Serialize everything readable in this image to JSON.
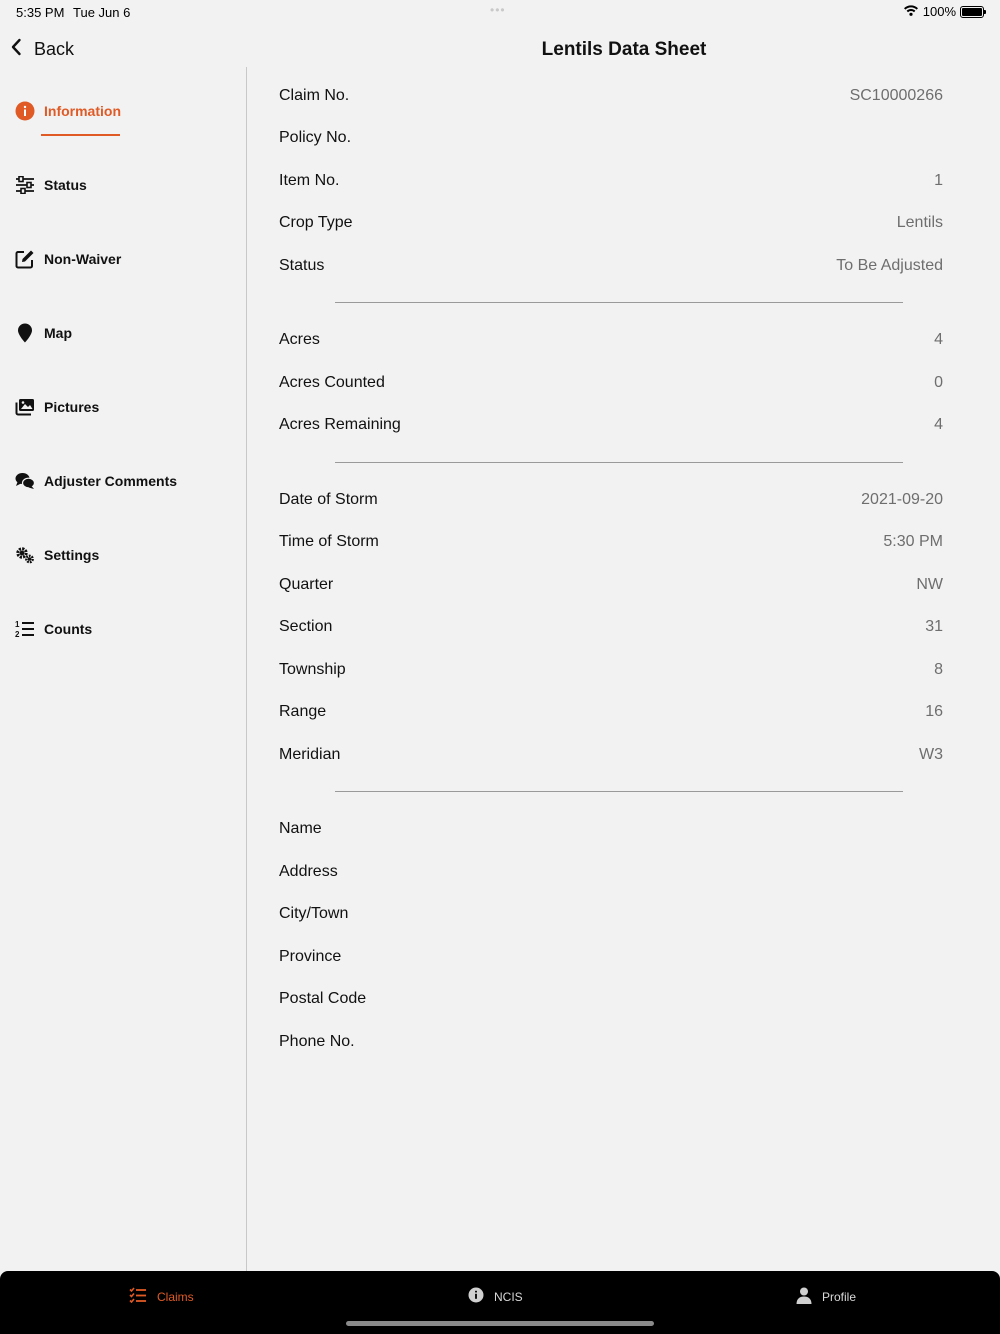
{
  "status_bar": {
    "time": "5:35 PM",
    "date": "Tue Jun 6",
    "battery": "100%"
  },
  "header": {
    "back_label": "Back",
    "title": "Lentils Data Sheet"
  },
  "sidebar": {
    "items": [
      {
        "label": "Information",
        "icon": "info-icon",
        "active": true
      },
      {
        "label": "Status",
        "icon": "sliders-icon"
      },
      {
        "label": "Non-Waiver",
        "icon": "edit-icon"
      },
      {
        "label": "Map",
        "icon": "map-pin-icon"
      },
      {
        "label": "Pictures",
        "icon": "pictures-icon"
      },
      {
        "label": "Adjuster Comments",
        "icon": "comments-icon"
      },
      {
        "label": "Settings",
        "icon": "gears-icon"
      },
      {
        "label": "Counts",
        "icon": "numbered-list-icon"
      }
    ]
  },
  "sections": {
    "claim": [
      {
        "label": "Claim No.",
        "value": "SC10000266"
      },
      {
        "label": "Policy No.",
        "value": ""
      },
      {
        "label": "Item No.",
        "value": "1"
      },
      {
        "label": "Crop Type",
        "value": "Lentils"
      },
      {
        "label": "Status",
        "value": "To Be Adjusted"
      }
    ],
    "acres": [
      {
        "label": "Acres",
        "value": "4"
      },
      {
        "label": "Acres Counted",
        "value": "0"
      },
      {
        "label": "Acres Remaining",
        "value": "4"
      }
    ],
    "storm": [
      {
        "label": "Date of Storm",
        "value": "2021-09-20"
      },
      {
        "label": "Time of Storm",
        "value": "5:30 PM"
      },
      {
        "label": "Quarter",
        "value": "NW"
      },
      {
        "label": "Section",
        "value": "31"
      },
      {
        "label": "Township",
        "value": "8"
      },
      {
        "label": "Range",
        "value": "16"
      },
      {
        "label": "Meridian",
        "value": "W3"
      }
    ],
    "contact": [
      {
        "label": "Name",
        "value": ""
      },
      {
        "label": "Address",
        "value": ""
      },
      {
        "label": "City/Town",
        "value": ""
      },
      {
        "label": "Province",
        "value": ""
      },
      {
        "label": "Postal Code",
        "value": ""
      },
      {
        "label": "Phone No.",
        "value": ""
      }
    ]
  },
  "tabbar": {
    "tabs": [
      {
        "label": "Claims",
        "icon": "checklist-icon",
        "active": true
      },
      {
        "label": "NCIS",
        "icon": "info-icon"
      },
      {
        "label": "Profile",
        "icon": "person-icon"
      }
    ]
  },
  "colors": {
    "accent": "#e05a25",
    "background": "#f2f2f2",
    "tabbar": "#000000",
    "value_text": "#6e6e6e"
  }
}
